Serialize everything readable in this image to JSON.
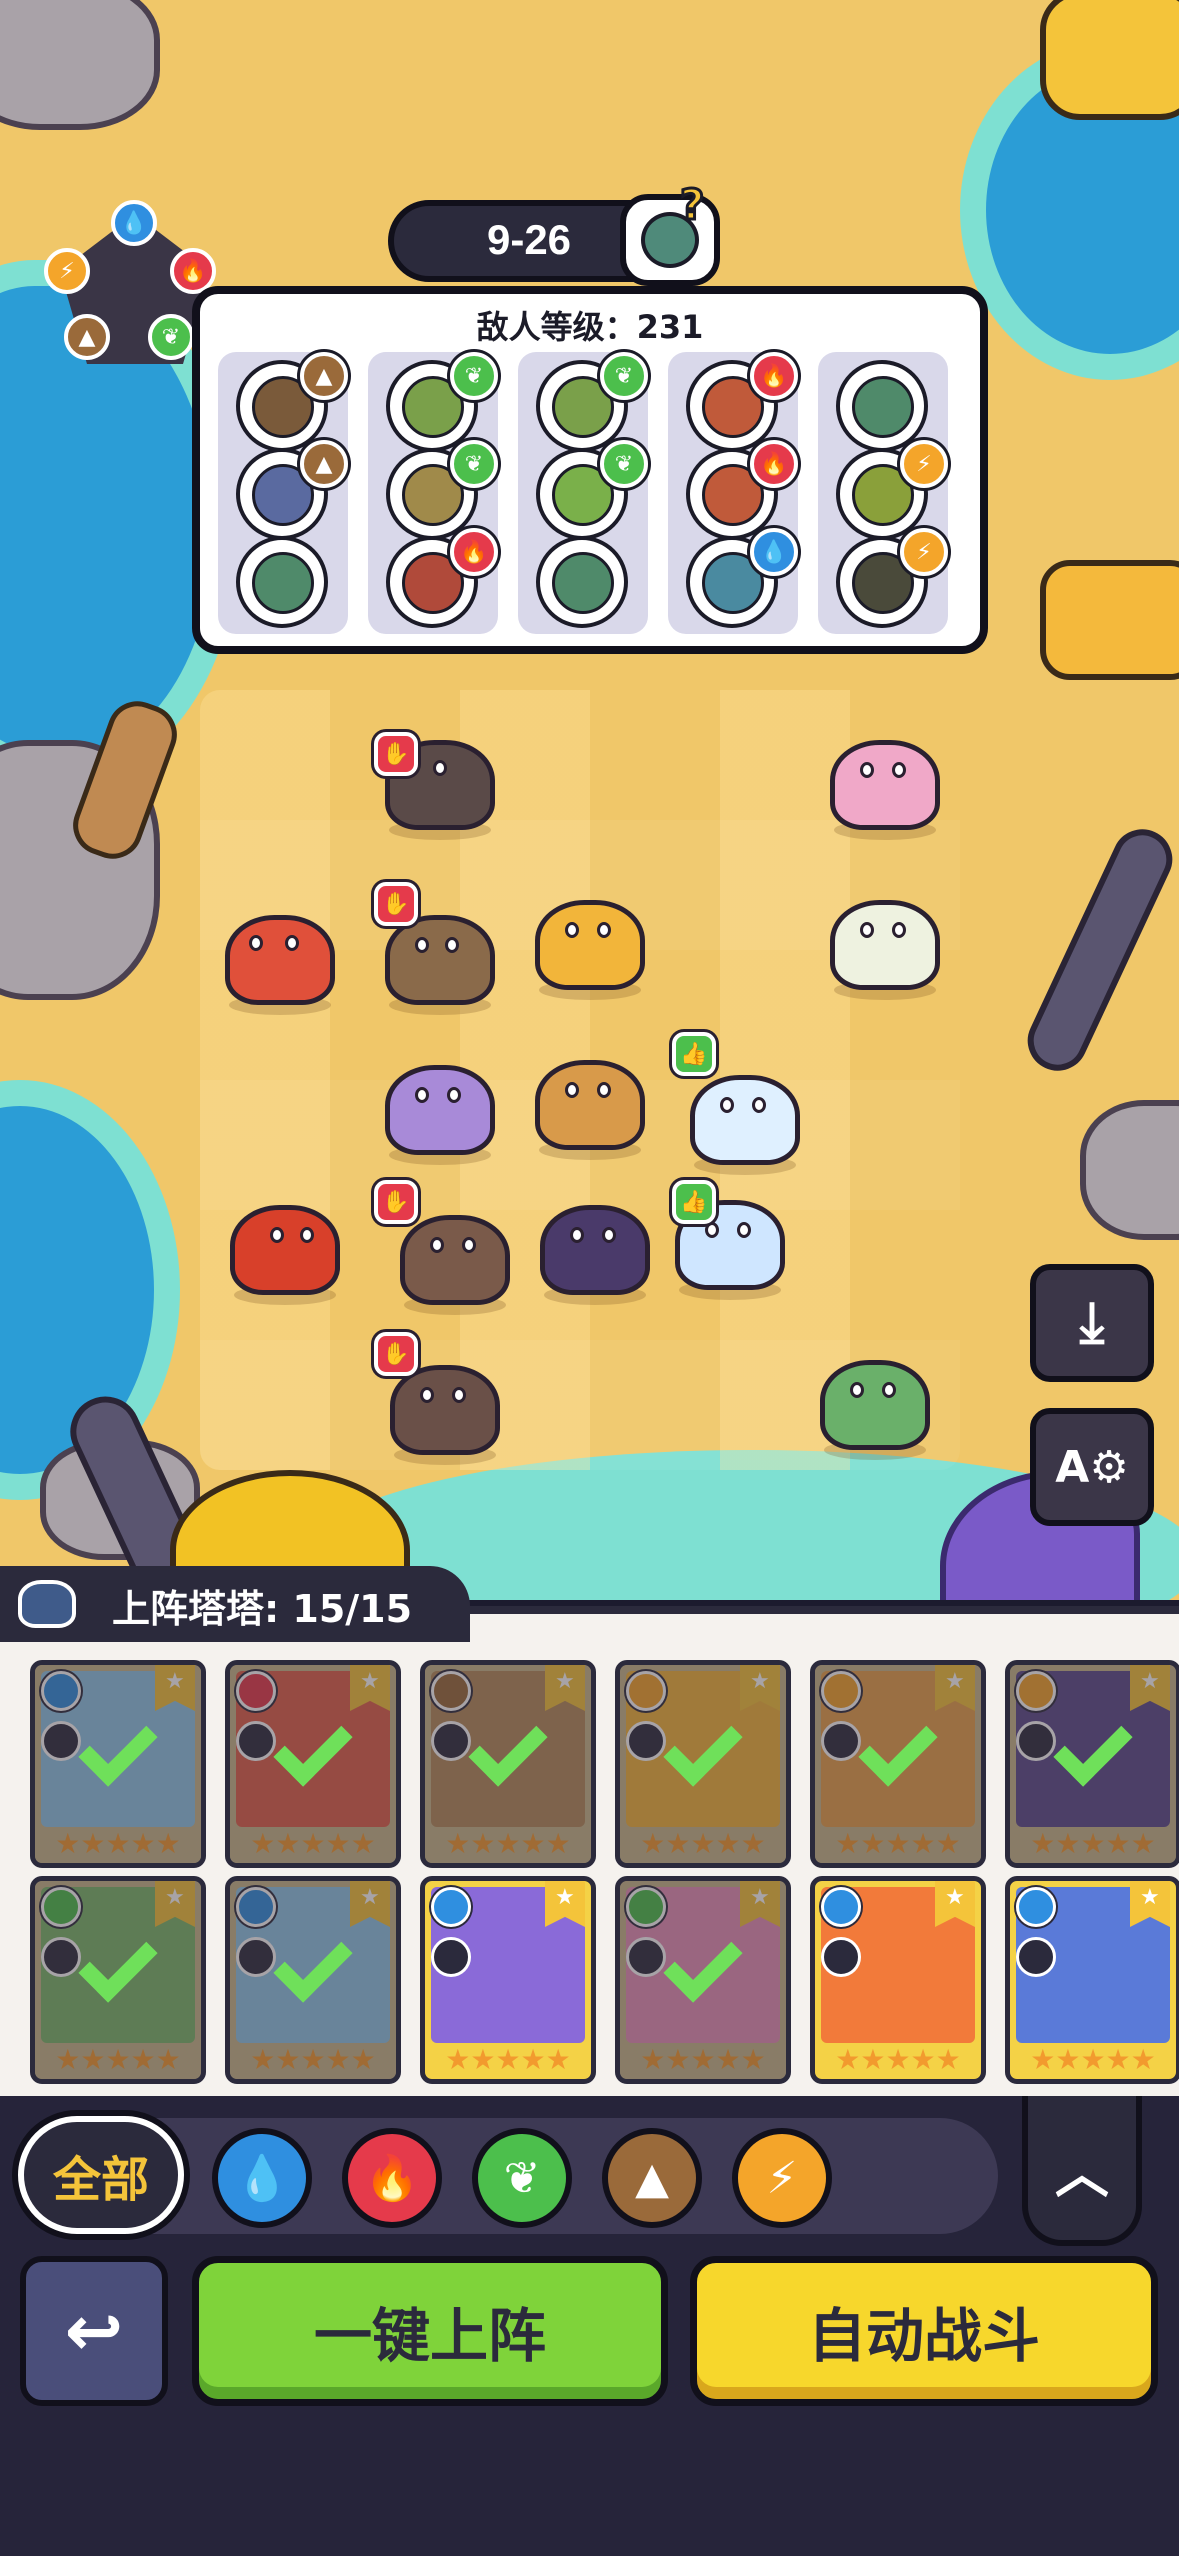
{
  "stage": {
    "label": "9-26",
    "boss_hint": "?"
  },
  "enemy_panel": {
    "level_label": "敌人等级：231",
    "columns": [
      {
        "slots": [
          {
            "color": "#7a5a3a",
            "badge": "earth"
          },
          {
            "color": "#5a6aa0",
            "badge": "earth"
          },
          {
            "color": "#4f8a6a",
            "badge": null
          }
        ]
      },
      {
        "slots": [
          {
            "color": "#7aa04a",
            "badge": "leaf"
          },
          {
            "color": "#a08a4a",
            "badge": "leaf"
          },
          {
            "color": "#b04a3a",
            "badge": "fire"
          }
        ]
      },
      {
        "slots": [
          {
            "color": "#7aa04a",
            "badge": "leaf"
          },
          {
            "color": "#7ab04a",
            "badge": "leaf"
          },
          {
            "color": "#4f8a6a",
            "badge": null
          }
        ]
      },
      {
        "slots": [
          {
            "color": "#c05a3a",
            "badge": "fire"
          },
          {
            "color": "#c05a3a",
            "badge": "fire"
          },
          {
            "color": "#4a8aa0",
            "badge": "water"
          }
        ]
      },
      {
        "slots": [
          {
            "color": "#4f8a6a",
            "badge": null
          },
          {
            "color": "#8aa03a",
            "badge": "bolt"
          },
          {
            "color": "#4a4a3a",
            "badge": "bolt"
          }
        ]
      }
    ]
  },
  "element_colors": {
    "water": "#2f8fe0",
    "fire": "#e53a4b",
    "leaf": "#4cbf4c",
    "earth": "#9a6a3a",
    "bolt": "#f4a52a"
  },
  "bench": {
    "title": "上阵塔塔: 15/15",
    "rows": [
      [
        {
          "elem": "water",
          "color": "#8fc7e8",
          "checked": true
        },
        {
          "elem": "fire",
          "color": "#e0604a",
          "checked": true
        },
        {
          "elem": "earth",
          "color": "#b58a5a",
          "checked": true
        },
        {
          "elem": "bolt",
          "color": "#f2b53a",
          "checked": true
        },
        {
          "elem": "bolt",
          "color": "#e8a04a",
          "checked": true
        },
        {
          "elem": "bolt",
          "color": "#5a4a8a",
          "checked": true
        }
      ],
      [
        {
          "elem": "leaf",
          "color": "#7ab86a",
          "checked": true
        },
        {
          "elem": "water",
          "color": "#8fc7e8",
          "checked": true
        },
        {
          "elem": "water",
          "color": "#8a6ad8",
          "checked": false
        },
        {
          "elem": "leaf",
          "color": "#e890b8",
          "checked": true
        },
        {
          "elem": "water",
          "color": "#f27a3a",
          "checked": false
        },
        {
          "elem": "water",
          "color": "#5a7ad8",
          "checked": false
        }
      ]
    ],
    "stars": "★★★★★"
  },
  "filters": {
    "all_label": "全部",
    "elements": [
      "water",
      "fire",
      "leaf",
      "earth",
      "bolt"
    ]
  },
  "icons": {
    "water": "💧",
    "fire": "🔥",
    "leaf": "❦",
    "earth": "▲",
    "bolt": "⚡",
    "thumb_down": "✋",
    "thumb_up": "👍",
    "download": "⤓",
    "auto_settings": "A⚙",
    "collapse": "︿",
    "back": "↩"
  },
  "buttons": {
    "deploy_label": "一键上阵",
    "auto_battle_label": "自动战斗"
  }
}
